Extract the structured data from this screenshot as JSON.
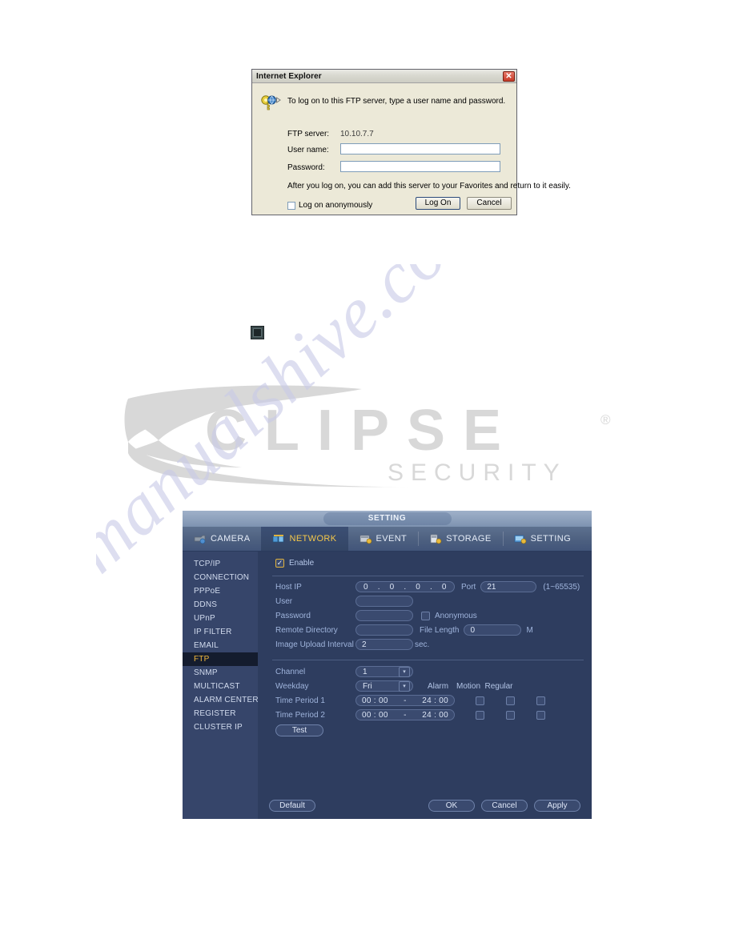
{
  "ie_dialog": {
    "title": "Internet Explorer",
    "close_icon": "close-icon",
    "key_icon": "key-globe-icon",
    "prompt": "To log on to this FTP server, type a user name and password.",
    "ftp_server_label": "FTP server:",
    "ftp_server_value": "10.10.7.7",
    "username_label": "User name:",
    "username_value": "",
    "password_label": "Password:",
    "password_value": "",
    "note": "After you log on, you can add this server to your Favorites and return to it easily.",
    "anonymous_label": "Log on anonymously",
    "anonymous_checked": false,
    "logon_button": "Log On",
    "cancel_button": "Cancel"
  },
  "watermarks": {
    "logo_primary": "ECLIPSE",
    "logo_secondary": "SECURITY",
    "logo_registered": "®",
    "diagonal": "manualshive.com"
  },
  "square_icon": {
    "name": "small-square-button-icon"
  },
  "dvr": {
    "window_title": "SETTING",
    "tabs": [
      {
        "label": "CAMERA",
        "icon": "camera-icon",
        "active": false
      },
      {
        "label": "NETWORK",
        "icon": "network-icon",
        "active": true
      },
      {
        "label": "EVENT",
        "icon": "event-icon",
        "active": false
      },
      {
        "label": "STORAGE",
        "icon": "storage-icon",
        "active": false
      },
      {
        "label": "SETTING",
        "icon": "setting-icon",
        "active": false
      }
    ],
    "sidebar": [
      {
        "label": "TCP/IP",
        "active": false
      },
      {
        "label": "CONNECTION",
        "active": false
      },
      {
        "label": "PPPoE",
        "active": false
      },
      {
        "label": "DDNS",
        "active": false
      },
      {
        "label": "UPnP",
        "active": false
      },
      {
        "label": "IP FILTER",
        "active": false
      },
      {
        "label": "EMAIL",
        "active": false
      },
      {
        "label": "FTP",
        "active": true
      },
      {
        "label": "SNMP",
        "active": false
      },
      {
        "label": "MULTICAST",
        "active": false
      },
      {
        "label": "ALARM CENTER",
        "active": false
      },
      {
        "label": "REGISTER",
        "active": false
      },
      {
        "label": "CLUSTER IP",
        "active": false
      }
    ],
    "form": {
      "enable_label": "Enable",
      "enable_checked": true,
      "enable_check_glyph": "✓",
      "host_ip_label": "Host IP",
      "host_ip_octets": [
        "0",
        "0",
        "0",
        "0"
      ],
      "host_ip_separator": ".",
      "port_label": "Port",
      "port_value": "21",
      "port_range": "(1~65535)",
      "user_label": "User",
      "user_value": "",
      "password_label": "Password",
      "password_value": "",
      "anonymous_label": "Anonymous",
      "anonymous_checked": false,
      "remote_directory_label": "Remote Directory",
      "remote_directory_value": "",
      "file_length_label": "File Length",
      "file_length_value": "0",
      "file_length_unit": "M",
      "image_upload_label": "Image Upload Interval",
      "image_upload_value": "2",
      "image_upload_unit": "sec.",
      "channel_label": "Channel",
      "channel_value": "1",
      "weekday_label": "Weekday",
      "weekday_value": "Fri",
      "dropdown_arrow": "▾",
      "col_alarm": "Alarm",
      "col_motion": "Motion",
      "col_regular": "Regular",
      "time_period_1_label": "Time Period 1",
      "time_period_1_start": "00 : 00",
      "time_period_1_dash": "-",
      "time_period_1_end": "24 : 00",
      "tp1_alarm_checked": false,
      "tp1_motion_checked": false,
      "tp1_regular_checked": false,
      "time_period_2_label": "Time Period 2",
      "time_period_2_start": "00 : 00",
      "time_period_2_dash": "-",
      "time_period_2_end": "24 : 00",
      "tp2_alarm_checked": false,
      "tp2_motion_checked": false,
      "tp2_regular_checked": false,
      "test_button": "Test"
    },
    "footer": {
      "default_button": "Default",
      "ok_button": "OK",
      "cancel_button": "Cancel",
      "apply_button": "Apply"
    }
  },
  "colors": {
    "panel_bg": "#2e3d5f",
    "sidebar_bg": "#36456a",
    "sidebar_active_bg": "#141c2e",
    "accent_gold": "#f2b93c",
    "label_blue": "#9fb4dc",
    "ie_face": "#ece9d8",
    "ie_close_red": "#c63a27",
    "watermark_grey": "#d9d9d9",
    "watermark_violet": "#c9cbe8"
  }
}
